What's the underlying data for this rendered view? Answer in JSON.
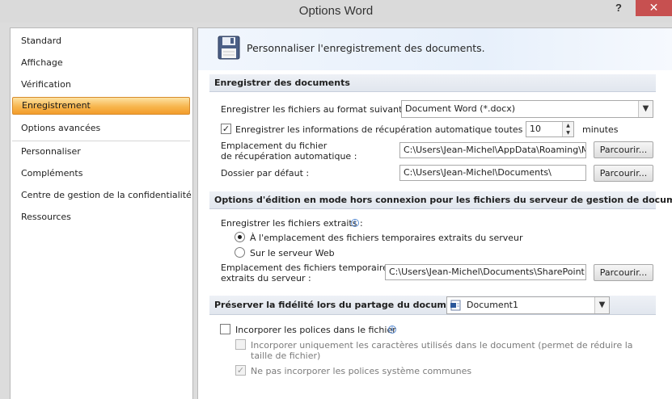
{
  "window": {
    "title": "Options Word",
    "help_label": "?",
    "close_label": "✕"
  },
  "sidebar": {
    "items": [
      {
        "label": "Standard"
      },
      {
        "label": "Affichage"
      },
      {
        "label": "Vérification"
      },
      {
        "label": "Enregistrement",
        "selected": true
      },
      {
        "label": "Options avancées"
      },
      {
        "label": "Personnaliser"
      },
      {
        "label": "Compléments"
      },
      {
        "label": "Centre de gestion de la confidentialité"
      },
      {
        "label": "Ressources"
      }
    ]
  },
  "main": {
    "banner_title": "Personnaliser l'enregistrement des documents.",
    "save_section": {
      "header": "Enregistrer des documents",
      "format_label": "Enregistrer les fichiers au format suivant :",
      "format_value": "Document Word (*.docx)",
      "autorecover_label": "Enregistrer les informations de récupération automatique toutes les",
      "autorecover_checked": true,
      "autorecover_minutes": "10",
      "minutes_label": "minutes",
      "recovery_location_label_1": "Emplacement du fichier",
      "recovery_location_label_2": "de récupération automatique :",
      "recovery_location_value": "C:\\Users\\Jean-Michel\\AppData\\Roaming\\Microsoft\\Word\\",
      "browse_label": "Parcourir...",
      "default_folder_label": "Dossier par défaut :",
      "default_folder_value": "C:\\Users\\Jean-Michel\\Documents\\"
    },
    "offline_section": {
      "header": "Options d'édition en mode hors connexion pour les fichiers du serveur de gestion de documents",
      "save_checked_out_label": "Enregistrer les fichiers extraits :",
      "option_temp_label": "À l'emplacement des fichiers temporaires extraits du serveur",
      "option_temp_selected": true,
      "option_web_label": "Sur le serveur Web",
      "option_web_selected": false,
      "temp_location_label_1": "Emplacement des fichiers temporaires",
      "temp_location_label_2": "extraits du serveur :",
      "temp_location_value": "C:\\Users\\Jean-Michel\\Documents\\SharePoint Fichiers en attente\\",
      "browse_label": "Parcourir..."
    },
    "fidelity_section": {
      "header": "Préserver la fidélité lors du partage du document :",
      "document_value": "Document1",
      "embed_fonts_label": "Incorporer les polices dans le fichier",
      "embed_fonts_checked": false,
      "embed_used_chars_label": "Incorporer uniquement les caractères utilisés dans le document (permet de réduire la taille de fichier)",
      "embed_used_chars_checked": false,
      "no_common_fonts_label": "Ne pas incorporer les polices système communes",
      "no_common_fonts_checked": true
    }
  }
}
